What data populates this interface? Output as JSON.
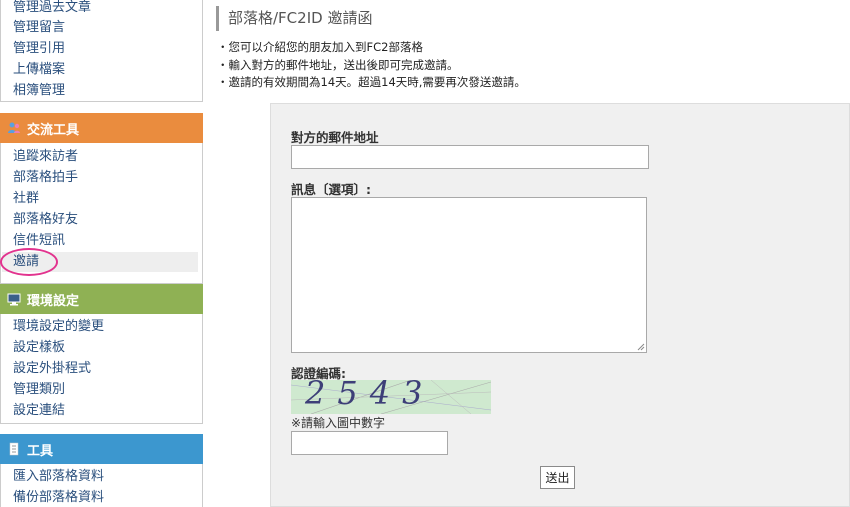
{
  "sidebar": {
    "top_links": [
      "管理過去文章",
      "管理留言",
      "管理引用",
      "上傳檔案",
      "相簿管理"
    ],
    "communication": {
      "title": "交流工具",
      "icon": "people-icon",
      "links": [
        "追蹤來訪者",
        "部落格拍手",
        "社群",
        "部落格好友",
        "信件短訊",
        "邀請"
      ]
    },
    "environment": {
      "title": "環境設定",
      "icon": "monitor-icon",
      "links": [
        "環境設定的變更",
        "設定樣板",
        "設定外掛程式",
        "管理類別",
        "設定連結"
      ]
    },
    "tools": {
      "title": "工具",
      "icon": "document-icon",
      "links": [
        "匯入部落格資料",
        "備份部落格資料"
      ]
    },
    "colors": {
      "orange": "#ea8c3e",
      "green": "#8fb154",
      "blue": "#3c97cf",
      "highlight": "#e2338e"
    }
  },
  "main": {
    "title": "部落格/FC2ID 邀請函",
    "info": [
      "・您可以介紹您的朋友加入到FC2部落格",
      "・輸入對方的郵件地址，送出後即可完成邀請。",
      "・邀請的有效期間為14天。超過14天時,需要再次發送邀請。"
    ],
    "form": {
      "email_label": "對方的郵件地址",
      "email_value": "",
      "message_label": "訊息〔選項〕:",
      "message_value": "",
      "captcha_label": "認證編碼:",
      "captcha_text": "2543",
      "captcha_hint": "※請輸入圖中數字",
      "captcha_value": "",
      "submit_label": "送出"
    }
  }
}
